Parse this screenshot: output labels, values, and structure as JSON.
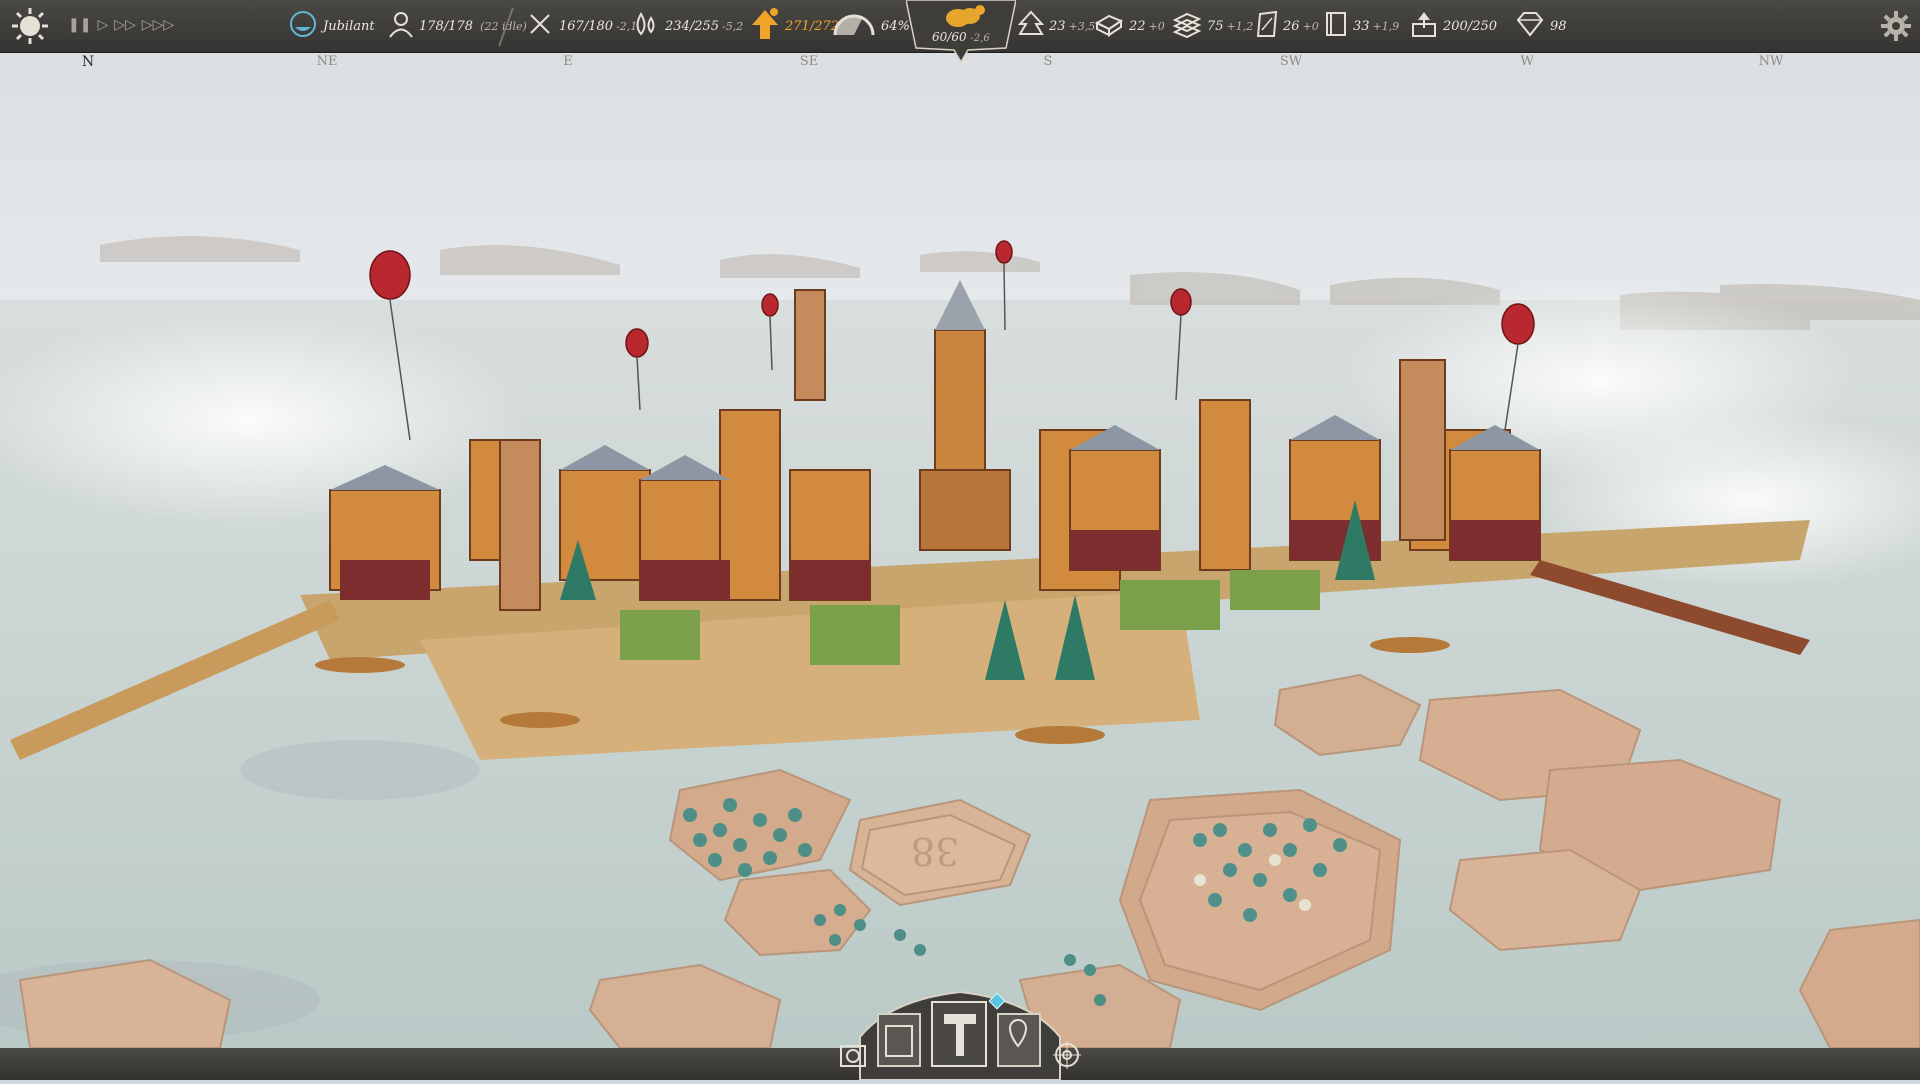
{
  "hud": {
    "mood": {
      "label": "Jubilant",
      "icon": "mood-face-icon"
    },
    "population": {
      "value": "178/178",
      "idle": "(22 idle)",
      "icon": "person-icon"
    },
    "food": {
      "value": "167/180",
      "delta": "-2,1",
      "icon": "fork-knife-icon"
    },
    "water": {
      "value": "234/255",
      "delta": "-5,2",
      "icon": "water-drops-icon"
    },
    "lift": {
      "value": "271/272",
      "icon": "lift-arrow-icon",
      "color": "#f0a52a"
    },
    "speed_gauge": {
      "value": "64%",
      "icon": "speedometer-icon"
    },
    "center": {
      "value": "60/60",
      "delta": "-2,6",
      "icon": "ship-status-icon"
    },
    "wood": {
      "value": "23",
      "delta": "+3,5",
      "icon": "tree-icon"
    },
    "stone": {
      "value": "22",
      "delta": "+0",
      "icon": "block-icon"
    },
    "planks": {
      "value": "75",
      "delta": "+1,2",
      "icon": "planks-icon"
    },
    "fabric": {
      "value": "26",
      "delta": "+0",
      "icon": "fabric-icon"
    },
    "books": {
      "value": "33",
      "delta": "+1,9",
      "icon": "book-icon"
    },
    "storage": {
      "value": "200/250",
      "icon": "storage-icon"
    },
    "gems": {
      "value": "98",
      "icon": "diamond-icon"
    }
  },
  "compass": [
    "N",
    "NE",
    "E",
    "SE",
    "S",
    "SW",
    "W",
    "NW"
  ],
  "map_label": "38",
  "icons": {
    "day_night": "sun-icon",
    "pause": "pause-icon",
    "play": "play-icon",
    "fast": "fast-forward-icon",
    "fastest": "fastest-forward-icon",
    "settings": "gear-icon",
    "bottom": [
      "camera-icon",
      "book-icon",
      "hammer-icon",
      "map-pin-icon",
      "target-icon"
    ]
  },
  "colors": {
    "hud_bg": "#3f3d3a",
    "accent_warning": "#f0a52a",
    "text": "#ebe6dc"
  }
}
